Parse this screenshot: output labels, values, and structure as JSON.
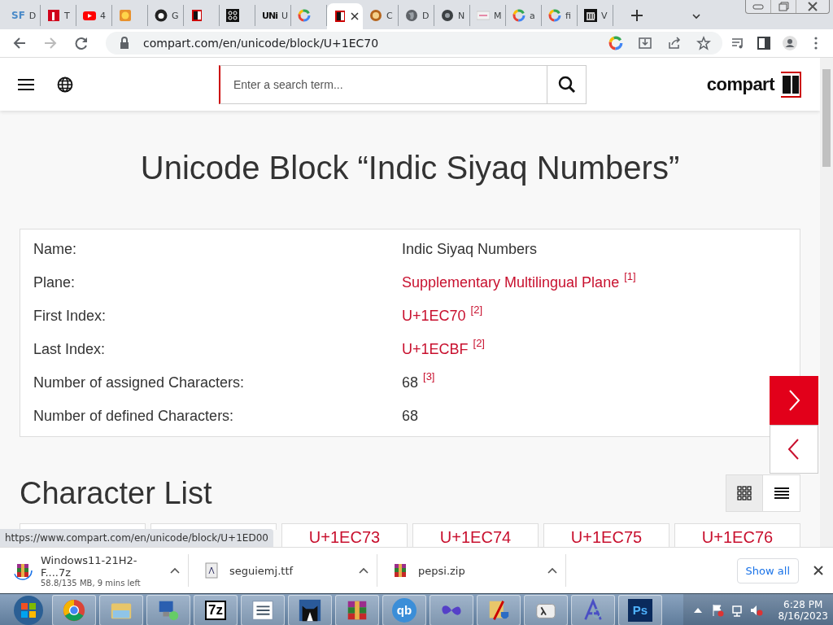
{
  "browser": {
    "tabs": [
      {
        "kind": "text",
        "badge": "SF",
        "title": "D",
        "selected": false
      },
      {
        "kind": "red",
        "title": "T",
        "selected": false
      },
      {
        "kind": "youtube",
        "title": "4",
        "selected": false
      },
      {
        "kind": "face",
        "selected": false
      },
      {
        "kind": "github",
        "title": "G",
        "selected": false
      },
      {
        "kind": "compart",
        "selected": false
      },
      {
        "kind": "command",
        "selected": false
      },
      {
        "kind": "text",
        "badge": "UNi",
        "title": "U",
        "selected": false
      },
      {
        "kind": "google",
        "selected": false
      },
      {
        "kind": "compart",
        "selected": true
      },
      {
        "kind": "pizza",
        "title": "C",
        "selected": false
      },
      {
        "kind": "globe",
        "title": "D",
        "selected": false
      },
      {
        "kind": "chrome",
        "title": "N",
        "selected": false
      },
      {
        "kind": "image",
        "title": "M",
        "selected": false
      },
      {
        "kind": "google",
        "title": "a",
        "selected": false
      },
      {
        "kind": "google",
        "title": "fi",
        "selected": false
      },
      {
        "kind": "bank",
        "title": "V",
        "selected": false
      }
    ],
    "address": "compart.com/en/unicode/block/U+1EC70"
  },
  "header": {
    "search": {
      "placeholder": "Enter a search term..."
    },
    "logo": "compart"
  },
  "title": "Unicode Block “Indic Siyaq Numbers”",
  "properties": [
    {
      "label": "Name:",
      "value": "Indic Siyaq Numbers",
      "kind": "text"
    },
    {
      "label": "Plane:",
      "value": "Supplementary Multilingual Plane",
      "kind": "link",
      "note": "[1]"
    },
    {
      "label": "First Index:",
      "value": "U+1EC70",
      "kind": "link",
      "note": "[2]"
    },
    {
      "label": "Last Index:",
      "value": "U+1ECBF",
      "kind": "link",
      "note": "[2]"
    },
    {
      "label": "Number of assigned Characters:",
      "value": "68",
      "kind": "text",
      "note": "[3]"
    },
    {
      "label": "Number of defined Characters:",
      "value": "68",
      "kind": "text"
    }
  ],
  "character_list": {
    "heading": "Character List",
    "views": [
      {
        "kind": "grid",
        "selected": true
      },
      {
        "kind": "list",
        "selected": false
      }
    ],
    "cards": [
      {
        "covered": true
      },
      {
        "covered": true
      },
      {
        "code": "U+1EC73"
      },
      {
        "code": "U+1EC74"
      },
      {
        "code": "U+1EC75"
      },
      {
        "code": "U+1EC76"
      }
    ]
  },
  "status_url": "https://www.compart.com/en/unicode/block/U+1ED00",
  "downloads": {
    "items": [
      {
        "name": "Windows11-21H2-F....7z",
        "status": "58.8/135 MB, 9 mins left",
        "kind": "archive"
      },
      {
        "name": "seguiemj.ttf",
        "kind": "font"
      },
      {
        "name": "pepsi.zip",
        "kind": "archive"
      }
    ],
    "show_all": "Show all"
  },
  "taskbar": {
    "apps": [
      {
        "kind": "chrome"
      },
      {
        "kind": "folder"
      },
      {
        "kind": "remote"
      },
      {
        "kind": "sevenzip",
        "label": "7z"
      },
      {
        "kind": "list"
      },
      {
        "kind": "cat"
      },
      {
        "kind": "rar"
      },
      {
        "kind": "qbit",
        "label": "qb"
      },
      {
        "kind": "infinity"
      },
      {
        "kind": "shield"
      },
      {
        "kind": "lambda"
      },
      {
        "kind": "font"
      },
      {
        "kind": "photoshop",
        "label": "Ps"
      }
    ],
    "clock": {
      "time": "6:28 PM",
      "date": "8/16/2023"
    }
  }
}
